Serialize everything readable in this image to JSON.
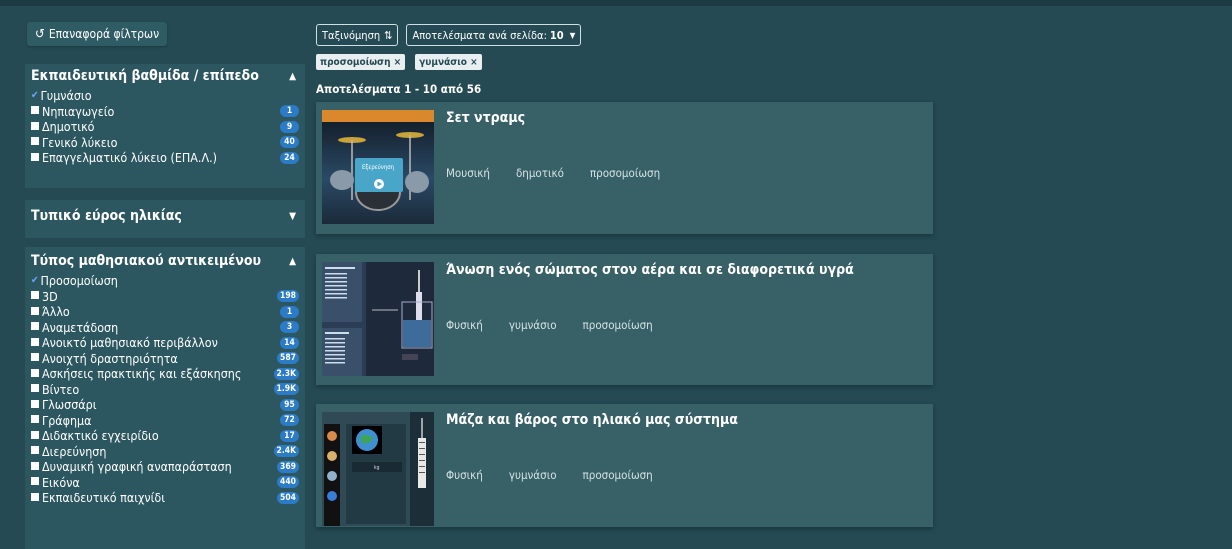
{
  "sidebar": {
    "reset_label": "Επαναφορά φίλτρων",
    "facets": [
      {
        "title": "Εκπαιδευτική βαθμίδα / επίπεδο",
        "options": [
          {
            "label": "Γυμνάσιο",
            "checked": true,
            "count": ""
          },
          {
            "label": "Νηπιαγωγείο",
            "checked": false,
            "count": "1"
          },
          {
            "label": "Δημοτικό",
            "checked": false,
            "count": "9"
          },
          {
            "label": "Γενικό λύκειο",
            "checked": false,
            "count": "40"
          },
          {
            "label": "Επαγγελματικό λύκειο (ΕΠΑ.Λ.)",
            "checked": false,
            "count": "24"
          }
        ]
      },
      {
        "title": "Τυπικό εύρος ηλικίας",
        "options": []
      },
      {
        "title": "Τύπος μαθησιακού αντικειμένου",
        "options": [
          {
            "label": "Προσομοίωση",
            "checked": true,
            "count": ""
          },
          {
            "label": "3D",
            "checked": false,
            "count": "198"
          },
          {
            "label": "Άλλο",
            "checked": false,
            "count": "1"
          },
          {
            "label": "Αναμετάδοση",
            "checked": false,
            "count": "3"
          },
          {
            "label": "Ανοικτό μαθησιακό περιβάλλον",
            "checked": false,
            "count": "14"
          },
          {
            "label": "Ανοιχτή δραστηριότητα",
            "checked": false,
            "count": "587"
          },
          {
            "label": "Ασκήσεις πρακτικής και εξάσκησης",
            "checked": false,
            "count": "2.3K"
          },
          {
            "label": "Βίντεο",
            "checked": false,
            "count": "1.9K"
          },
          {
            "label": "Γλωσσάρι",
            "checked": false,
            "count": "95"
          },
          {
            "label": "Γράφημα",
            "checked": false,
            "count": "72"
          },
          {
            "label": "Διδακτικό εγχειρίδιο",
            "checked": false,
            "count": "17"
          },
          {
            "label": "Διερεύνηση",
            "checked": false,
            "count": "2.4K"
          },
          {
            "label": "Δυναμική γραφική αναπαράσταση",
            "checked": false,
            "count": "369"
          },
          {
            "label": "Εικόνα",
            "checked": false,
            "count": "440"
          },
          {
            "label": "Εκπαιδευτικό παιχνίδι",
            "checked": false,
            "count": "504"
          }
        ]
      }
    ]
  },
  "toolbar": {
    "sort_label": "Ταξινόμηση",
    "sort_icon": "⇅",
    "per_page_label": "Αποτελέσματα ανά σελίδα:",
    "per_page_value": "10"
  },
  "active_filters": [
    "προσομοίωση ×",
    "γυμνάσιο ×"
  ],
  "results_info": "Αποτελέσματα 1 - 10 από 56",
  "results": [
    {
      "title": "Σετ ντραμς",
      "tags": [
        "Μουσική",
        "δημοτικό",
        "προσομοίωση"
      ],
      "thumb_text": "Εξερεύνηση"
    },
    {
      "title": "Άνωση ενός σώματος στον αέρα και σε διαφορετικά υγρά",
      "tags": [
        "Φυσική",
        "γυμνάσιο",
        "προσομοίωση"
      ]
    },
    {
      "title": "Μάζα και βάρος στο ηλιακό μας σύστημα",
      "tags": [
        "Φυσική",
        "γυμνάσιο",
        "προσομοίωση"
      ]
    }
  ],
  "colors": {
    "background": "#254a54",
    "card": "#376067",
    "badge": "#2b7bc6"
  }
}
